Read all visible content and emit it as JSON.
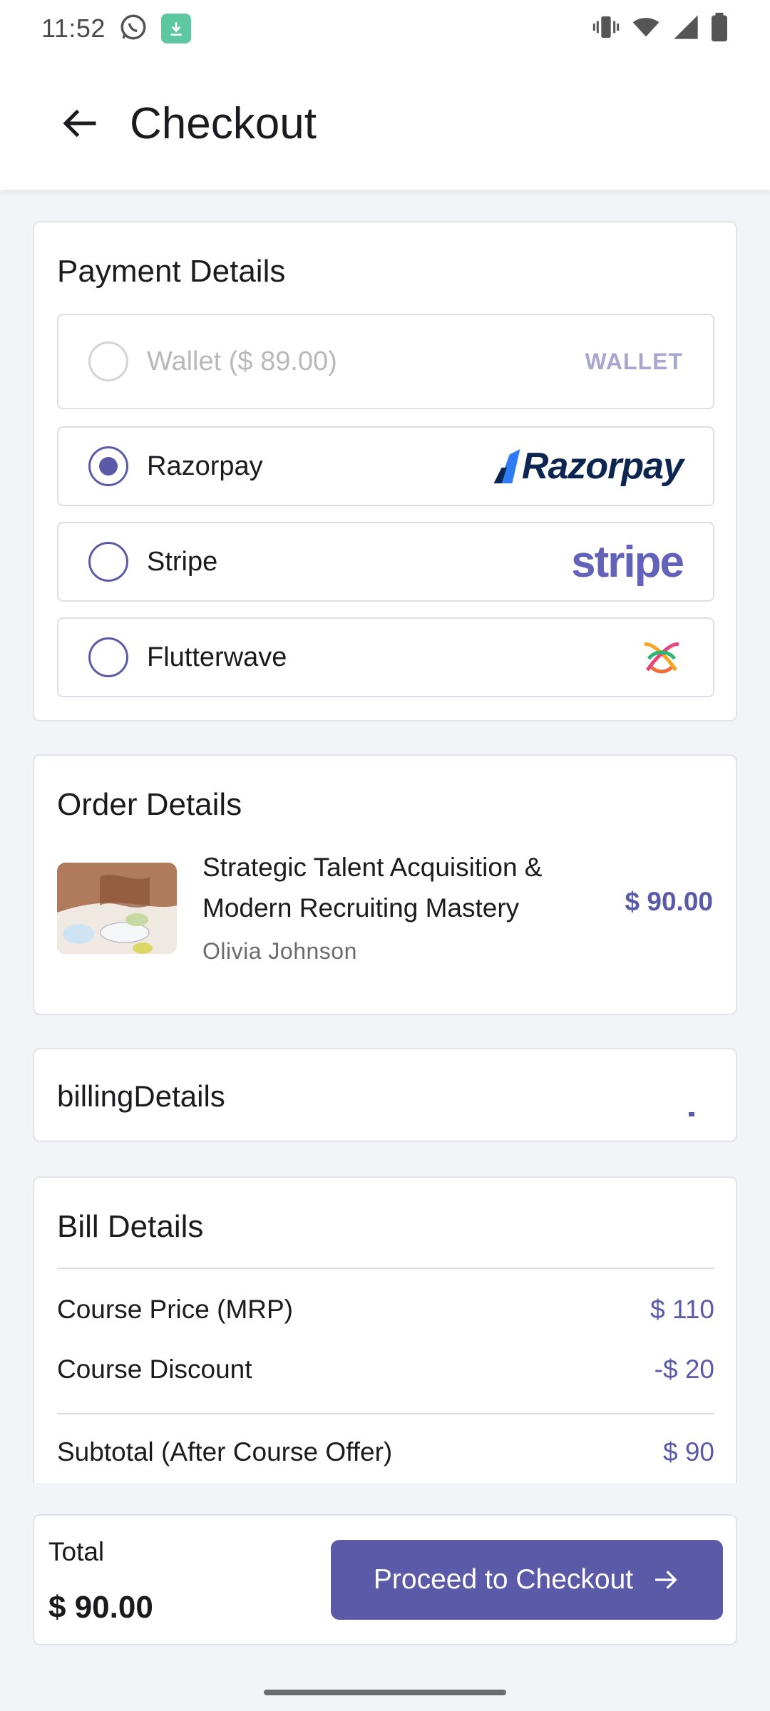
{
  "status_bar": {
    "time": "11:52"
  },
  "header": {
    "title": "Checkout"
  },
  "payment": {
    "title": "Payment Details",
    "options": [
      {
        "label": "Wallet ($ 89.00)",
        "tag": "WALLET",
        "disabled": true,
        "selected": false
      },
      {
        "label": "Razorpay",
        "tag": "Razorpay",
        "disabled": false,
        "selected": true
      },
      {
        "label": "Stripe",
        "tag": "stripe",
        "disabled": false,
        "selected": false
      },
      {
        "label": "Flutterwave",
        "tag": "",
        "disabled": false,
        "selected": false
      }
    ]
  },
  "order": {
    "title": "Order Details",
    "course_title": "Strategic Talent Acquisition & Modern Recruiting Mastery",
    "author": "Olivia Johnson",
    "price": "$ 90.00"
  },
  "billing": {
    "label": "billingDetails"
  },
  "bill": {
    "title": "Bill Details",
    "rows": [
      {
        "label": "Course Price (MRP)",
        "value": "$ 110"
      },
      {
        "label": "Course Discount",
        "value": "-$ 20"
      },
      {
        "label": "Subtotal (After Course Offer)",
        "value": "$ 90"
      }
    ]
  },
  "footer": {
    "total_label": "Total",
    "total_amount": "$ 90.00",
    "checkout_label": "Proceed to Checkout"
  },
  "colors": {
    "accent": "#5a5aa8",
    "wallet_tag": "#a7a6cf",
    "razorpay": "#0c2651",
    "stripe": "#6461b8"
  }
}
